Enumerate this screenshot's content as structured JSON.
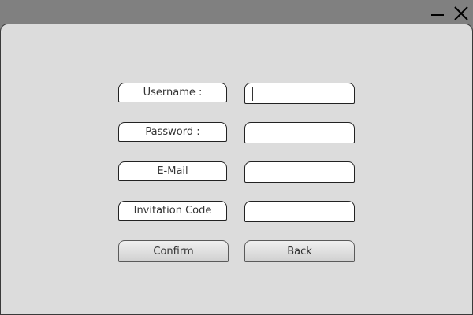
{
  "window": {
    "controls": {
      "minimize_icon": "minimize-icon",
      "close_icon": "close-icon"
    }
  },
  "form": {
    "username_label": "Username :",
    "username_value": "",
    "password_label": "Password :",
    "password_value": "",
    "email_label": "E-Mail",
    "email_value": "",
    "invitation_label": "Invitation Code",
    "invitation_value": "",
    "confirm_label": "Confirm",
    "back_label": "Back"
  },
  "colors": {
    "titlebar": "#808080",
    "panel": "#dcdcdc"
  }
}
